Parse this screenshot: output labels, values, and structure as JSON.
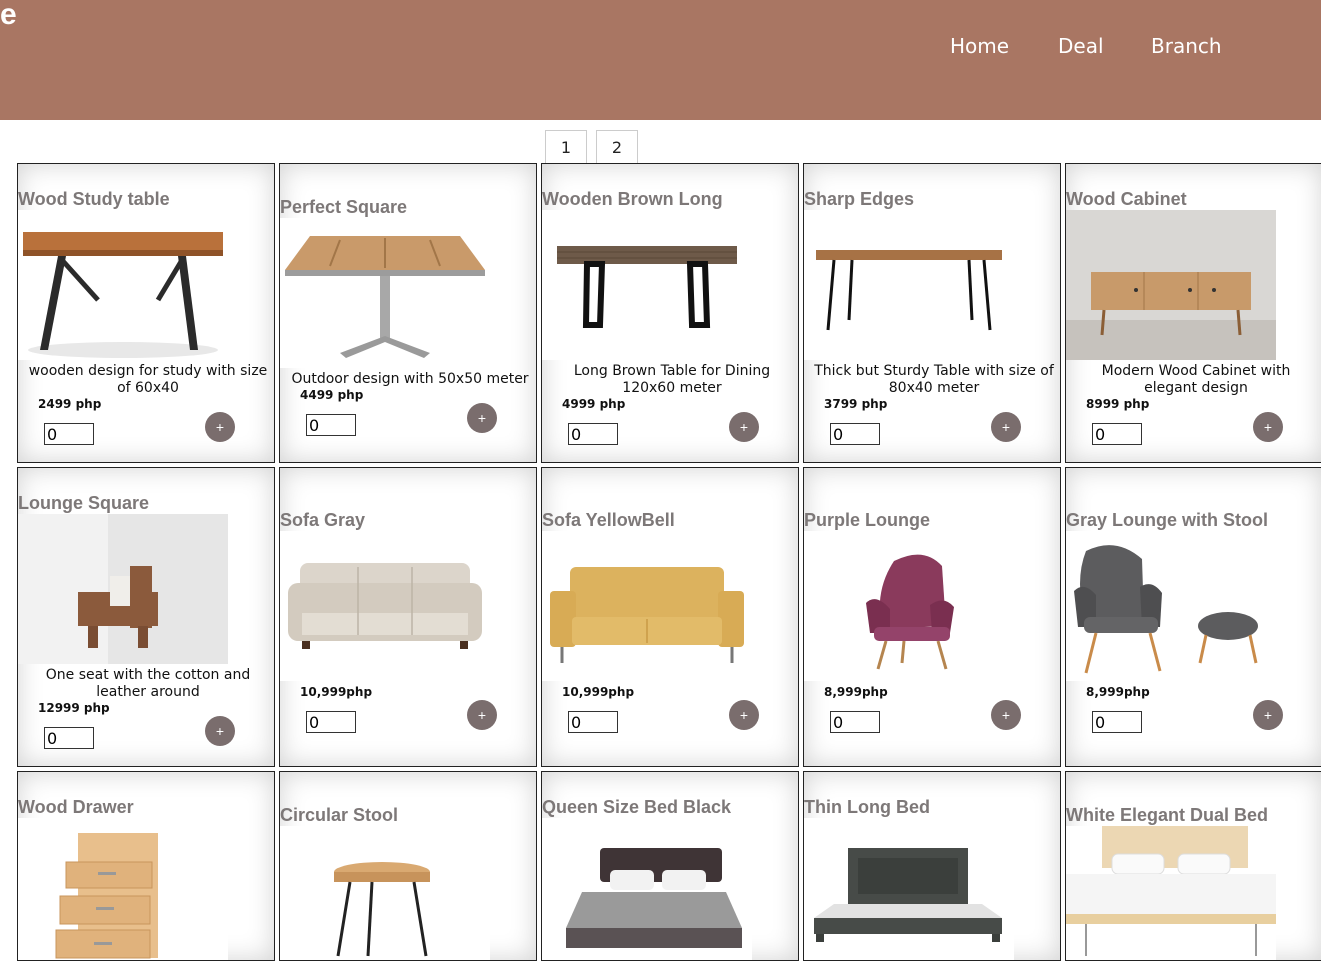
{
  "header": {
    "logo": "e",
    "nav": [
      "Home",
      "Deal",
      "Branch"
    ],
    "color": "#a97663"
  },
  "pagination": [
    "1",
    "2"
  ],
  "products": [
    {
      "title": "Wood Study table",
      "desc": "wooden design for study with size of 60x40",
      "price": "2499 php",
      "qty": "0",
      "add": "+"
    },
    {
      "title": "Perfect Square",
      "desc": "Outdoor design with 50x50 meter",
      "price": "4499 php",
      "qty": "0",
      "add": "+"
    },
    {
      "title": "Wooden Brown Long",
      "desc": "Long Brown Table for Dining 120x60 meter",
      "price": "4999 php",
      "qty": "0",
      "add": "+"
    },
    {
      "title": "Sharp Edges",
      "desc": "Thick but Sturdy Table with size of 80x40 meter",
      "price": "3799 php",
      "qty": "0",
      "add": "+"
    },
    {
      "title": "Wood Cabinet",
      "desc": "Modern Wood Cabinet with elegant design",
      "price": "8999 php",
      "qty": "0",
      "add": "+"
    },
    {
      "title": "Lounge Square",
      "desc": "One seat with the cotton and leather around",
      "price": "12999 php",
      "qty": "0",
      "add": "+"
    },
    {
      "title": "Sofa Gray",
      "desc": "",
      "price": "10,999php",
      "qty": "0",
      "add": "+"
    },
    {
      "title": "Sofa YellowBell",
      "desc": "",
      "price": "10,999php",
      "qty": "0",
      "add": "+"
    },
    {
      "title": "Purple Lounge",
      "desc": "",
      "price": "8,999php",
      "qty": "0",
      "add": "+"
    },
    {
      "title": "Gray Lounge with Stool",
      "desc": "",
      "price": "8,999php",
      "qty": "0",
      "add": "+"
    },
    {
      "title": "Wood Drawer"
    },
    {
      "title": "Circular Stool"
    },
    {
      "title": "Queen Size Bed Black"
    },
    {
      "title": "Thin Long Bed"
    },
    {
      "title": "White Elegant Dual Bed"
    }
  ]
}
